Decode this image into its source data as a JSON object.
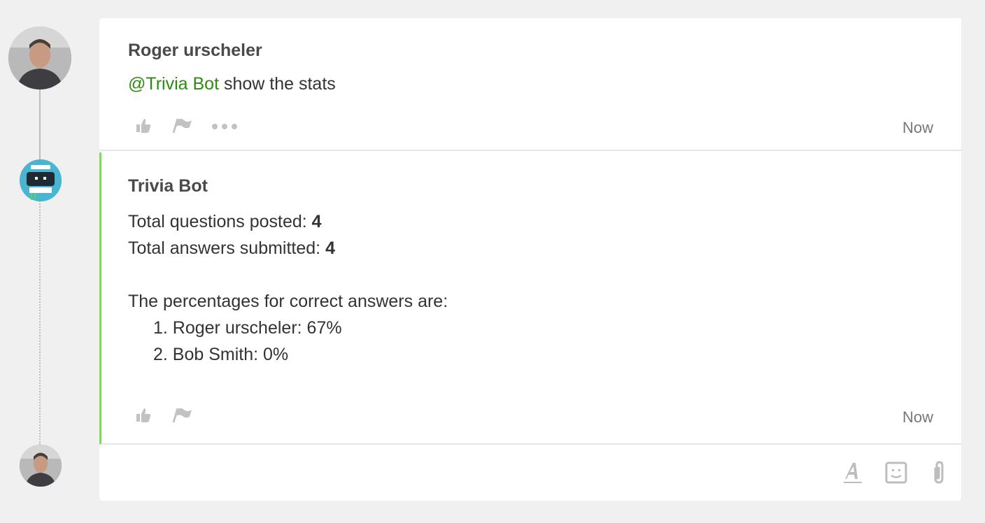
{
  "messages": [
    {
      "author": "Roger urscheler",
      "mention": "@Trivia Bot",
      "text": " show the stats",
      "time": "Now"
    },
    {
      "author": "Trivia Bot",
      "lines": {
        "questions_label": "Total questions posted: ",
        "questions_value": "4",
        "answers_label": "Total answers submitted: ",
        "answers_value": "4",
        "intro": "The percentages for correct answers are:",
        "rank_1": "1. Roger urscheler: 67%",
        "rank_2": "2. Bob Smith: 0%"
      },
      "time": "Now"
    }
  ],
  "icons": {
    "like": "thumbs-up-icon",
    "flag": "flag-icon",
    "more": "more-icon",
    "format": "text-format-icon",
    "emoji": "emoji-icon",
    "attach": "paperclip-icon"
  },
  "colors": {
    "mention": "#2e8b12",
    "bot_accent": "#8bd16b",
    "bot_avatar": "#49b5d0"
  }
}
